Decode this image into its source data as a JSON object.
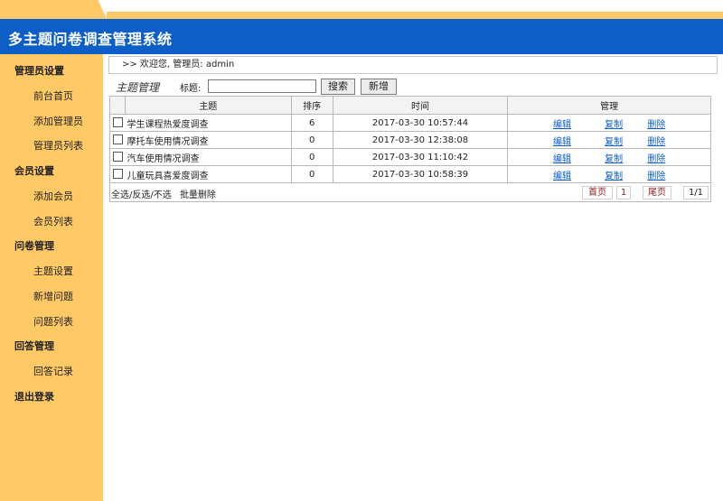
{
  "header": {
    "title": "多主题问卷调查管理系统"
  },
  "sidebar": {
    "groups": [
      {
        "label": "管理员设置",
        "items": [
          "前台首页",
          "添加管理员",
          "管理员列表"
        ]
      },
      {
        "label": "会员设置",
        "items": [
          "添加会员",
          "会员列表"
        ]
      },
      {
        "label": "问卷管理",
        "items": [
          "主题设置",
          "新增问题",
          "问题列表"
        ]
      },
      {
        "label": "回答管理",
        "items": [
          "回答记录"
        ]
      },
      {
        "label": "退出登录",
        "items": []
      }
    ]
  },
  "welcome": {
    "text": ">> 欢迎您, 管理员: admin"
  },
  "toolbar": {
    "section_title": "主题管理",
    "title_label": "标题:",
    "search_value": "",
    "search_button": "搜索",
    "new_button": "新增"
  },
  "table": {
    "headers": [
      "主题",
      "排序",
      "时间",
      "管理"
    ],
    "rows": [
      {
        "topic": "学生课程热爱度调查",
        "order": "6",
        "time": "2017-03-30 10:57:44"
      },
      {
        "topic": "摩托车使用情况调查",
        "order": "0",
        "time": "2017-03-30 12:38:08"
      },
      {
        "topic": "汽车使用情况调查",
        "order": "0",
        "time": "2017-03-30 11:10:42"
      },
      {
        "topic": "儿童玩具喜爱度调查",
        "order": "0",
        "time": "2017-03-30 10:58:39"
      }
    ],
    "actions": {
      "edit": "编辑",
      "copy": "复制",
      "delete": "删除"
    }
  },
  "footer": {
    "select_ops": "全选/反选/不选",
    "batch_delete": "批量删除",
    "first": "首页",
    "page": "1",
    "last": "尾页",
    "page_info": "1/1"
  },
  "colors": {
    "header_blue": "#0d5ec6",
    "sidebar_orange": "#ffc966",
    "link_blue": "#0b5ed1"
  }
}
